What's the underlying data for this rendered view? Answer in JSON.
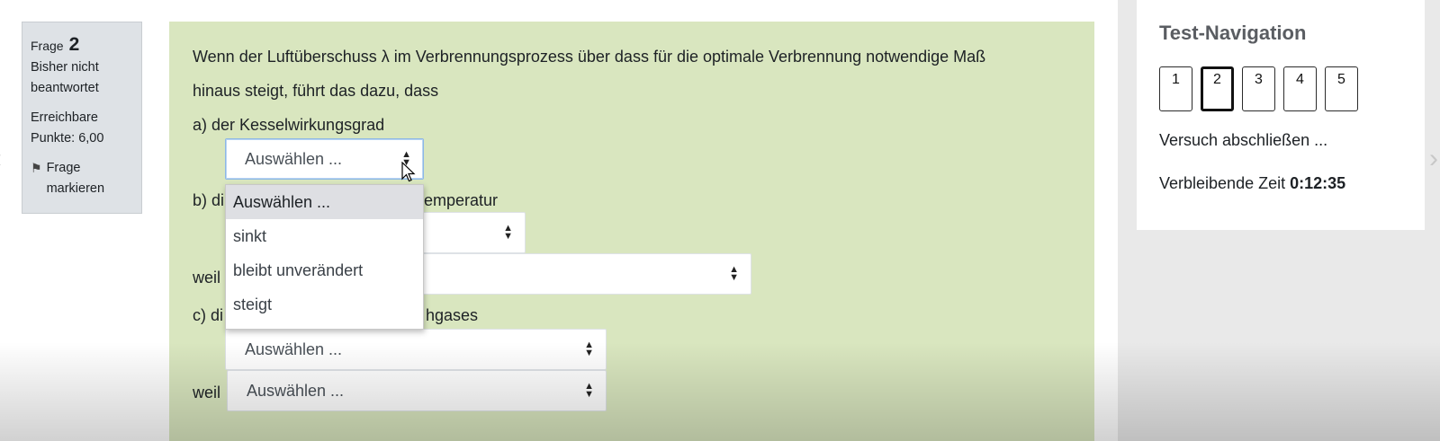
{
  "question_info": {
    "label": "Frage",
    "number": "2",
    "status": "Bisher nicht beantwortet",
    "points": "Erreichbare Punkte: 6,00",
    "flag_label": "Frage markieren"
  },
  "question": {
    "text": "Wenn der Luftüberschuss λ im  Verbrennungsprozess über dass für die optimale Verbrennung notwendige Maß",
    "text_line2": "hinaus steigt, führt das dazu, dass",
    "part_a": "a) der Kesselwirkungsgrad",
    "part_b_start": "b) di",
    "part_b_end": "emperatur",
    "part_c_start": "c) di",
    "part_c_end": "hgases",
    "weil_label": "weil",
    "select_placeholder": "Auswählen ..."
  },
  "dropdown_options": [
    "Auswählen ...",
    "sinkt",
    "bleibt unverändert",
    "steigt"
  ],
  "navigation": {
    "title": "Test-Navigation",
    "pages": [
      "1",
      "2",
      "3",
      "4",
      "5"
    ],
    "current_page": "2",
    "finish_label": "Versuch abschließen ...",
    "time_label": "Verbleibende Zeit",
    "time_value": "0:12:35"
  },
  "colors": {
    "question_bg": "#d9e6bf",
    "info_bg": "#dee2e6",
    "sidebar_bg": "#e9e9e9"
  }
}
